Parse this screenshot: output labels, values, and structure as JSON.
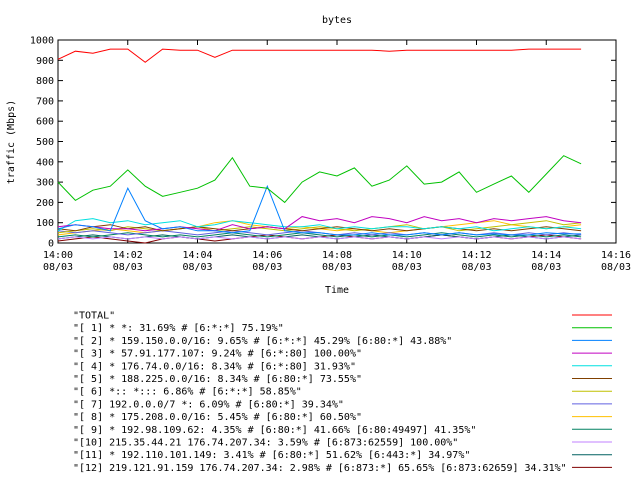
{
  "chart_data": {
    "type": "line",
    "title": "bytes",
    "xlabel": "Time",
    "ylabel": "traffic (Mbps)",
    "xlim": [
      "14:00",
      "14:16"
    ],
    "ylim": [
      0,
      1000
    ],
    "yticks": [
      0,
      100,
      200,
      300,
      400,
      500,
      600,
      700,
      800,
      900,
      1000
    ],
    "xticks": [
      {
        "time": "14:00",
        "date": "08/03"
      },
      {
        "time": "14:02",
        "date": "08/03"
      },
      {
        "time": "14:04",
        "date": "08/03"
      },
      {
        "time": "14:06",
        "date": "08/03"
      },
      {
        "time": "14:08",
        "date": "08/03"
      },
      {
        "time": "14:10",
        "date": "08/03"
      },
      {
        "time": "14:12",
        "date": "08/03"
      },
      {
        "time": "14:14",
        "date": "08/03"
      },
      {
        "time": "14:16",
        "date": "08/03"
      }
    ],
    "grid": false,
    "legend_placement": "bottom",
    "x": [
      "14:00",
      "14:00:30",
      "14:01",
      "14:01:30",
      "14:02",
      "14:02:30",
      "14:03",
      "14:03:30",
      "14:04",
      "14:04:30",
      "14:05",
      "14:05:30",
      "14:06",
      "14:06:30",
      "14:07",
      "14:07:30",
      "14:08",
      "14:08:30",
      "14:09",
      "14:09:30",
      "14:10",
      "14:10:30",
      "14:11",
      "14:11:30",
      "14:12",
      "14:12:30",
      "14:13",
      "14:13:30",
      "14:14",
      "14:14:30",
      "14:15"
    ],
    "series": [
      {
        "name": "\"TOTAL\"",
        "color": "#ff0000",
        "values": [
          905,
          945,
          935,
          955,
          955,
          890,
          955,
          950,
          950,
          915,
          950,
          950,
          950,
          950,
          950,
          950,
          950,
          950,
          950,
          945,
          950,
          950,
          950,
          950,
          950,
          950,
          950,
          955,
          955,
          955,
          955
        ]
      },
      {
        "name": "\"[ 1] * *: 31.69% # [6:*:*] 75.19%\"",
        "color": "#00c000",
        "values": [
          300,
          210,
          260,
          280,
          360,
          280,
          230,
          250,
          270,
          310,
          420,
          280,
          270,
          200,
          300,
          350,
          330,
          370,
          280,
          310,
          380,
          290,
          300,
          350,
          250,
          290,
          330,
          250,
          340,
          430,
          390
        ]
      },
      {
        "name": "\"[ 2] * 159.150.0.0/16: 9.65% # [6:*:*] 45.29% [6:80:*] 43.88%\"",
        "color": "#0080ff",
        "values": [
          70,
          90,
          80,
          60,
          270,
          110,
          70,
          80,
          60,
          60,
          50,
          60,
          280,
          60,
          50,
          50,
          40,
          40,
          50,
          40,
          40,
          50,
          40,
          50,
          40,
          45,
          40,
          40,
          50,
          45,
          45
        ]
      },
      {
        "name": "\"[ 3] * 57.91.177.107: 9.24% # [6:*:80] 100.00%\"",
        "color": "#c000c0",
        "values": [
          80,
          90,
          80,
          70,
          70,
          60,
          70,
          80,
          70,
          60,
          90,
          70,
          80,
          70,
          130,
          110,
          120,
          100,
          130,
          120,
          100,
          130,
          110,
          120,
          100,
          120,
          110,
          120,
          130,
          110,
          100
        ]
      },
      {
        "name": "\"[ 4] * 176.74.0.0/16: 8.34% # [6:*:80] 31.93%\"",
        "color": "#00e0e0",
        "values": [
          60,
          110,
          120,
          100,
          110,
          90,
          100,
          110,
          80,
          90,
          110,
          100,
          90,
          80,
          80,
          90,
          70,
          80,
          70,
          80,
          80,
          70,
          80,
          70,
          80,
          60,
          70,
          80,
          70,
          80,
          70
        ]
      },
      {
        "name": "\"[ 5] * 188.225.0.0/16: 8.34% # [6:80:*] 73.55%\"",
        "color": "#804000",
        "values": [
          70,
          60,
          80,
          90,
          70,
          80,
          60,
          70,
          80,
          70,
          60,
          70,
          80,
          70,
          60,
          70,
          80,
          70,
          60,
          70,
          60,
          70,
          80,
          70,
          60,
          70,
          60,
          70,
          80,
          70,
          60
        ]
      },
      {
        "name": "\"[ 6] *:: *::: 6.86% # [6:*:*] 58.85%\"",
        "color": "#c0c000",
        "values": [
          50,
          60,
          70,
          60,
          80,
          70,
          60,
          70,
          80,
          60,
          70,
          80,
          70,
          60,
          70,
          80,
          70,
          60,
          70,
          80,
          90,
          70,
          80,
          60,
          70,
          80,
          90,
          100,
          110,
          90,
          100
        ]
      },
      {
        "name": "\"[ 7] 192.0.0.0/7 *: 6.09% # [6:80:*] 39.34%\"",
        "color": "#6060e0",
        "values": [
          60,
          50,
          60,
          50,
          40,
          50,
          60,
          50,
          40,
          50,
          60,
          50,
          40,
          50,
          60,
          50,
          40,
          50,
          40,
          50,
          40,
          50,
          40,
          50,
          40,
          50,
          40,
          50,
          40,
          50,
          40
        ]
      },
      {
        "name": "\"[ 8] * 175.208.0.0/16: 5.45% # [6:80:*] 60.50%\"",
        "color": "#ffc000",
        "values": [
          40,
          50,
          60,
          70,
          60,
          50,
          60,
          70,
          80,
          100,
          110,
          90,
          80,
          70,
          80,
          70,
          60,
          70,
          60,
          50,
          60,
          70,
          80,
          90,
          100,
          110,
          90,
          80,
          70,
          80,
          90
        ]
      },
      {
        "name": "\"[ 9] * 192.98.109.62: 4.35% # [6:80:*] 41.66% [6:80:49497] 41.35%\"",
        "color": "#008060",
        "values": [
          30,
          40,
          30,
          40,
          50,
          40,
          30,
          40,
          30,
          40,
          50,
          40,
          30,
          40,
          50,
          40,
          30,
          40,
          30,
          40,
          30,
          40,
          50,
          40,
          30,
          40,
          30,
          40,
          30,
          40,
          30
        ]
      },
      {
        "name": "\"[10] 215.35.44.21 176.74.207.34: 3.59% # [6:873:62559] 100.00%\"",
        "color": "#c080ff",
        "values": [
          20,
          30,
          20,
          30,
          20,
          30,
          20,
          30,
          20,
          30,
          20,
          30,
          20,
          30,
          20,
          30,
          20,
          30,
          20,
          30,
          20,
          30,
          20,
          30,
          20,
          30,
          20,
          30,
          20,
          30,
          20
        ]
      },
      {
        "name": "\"[11] * 192.110.101.149: 3.41% # [6:80:*] 51.62% [6:443:*] 34.97%\"",
        "color": "#006060",
        "values": [
          20,
          30,
          40,
          30,
          20,
          30,
          40,
          30,
          20,
          30,
          40,
          30,
          20,
          30,
          40,
          30,
          20,
          30,
          40,
          30,
          20,
          30,
          40,
          30,
          20,
          30,
          40,
          30,
          20,
          30,
          40
        ]
      },
      {
        "name": "\"[12] 219.121.91.159 176.74.207.34: 2.98% # [6:873:*] 65.65% [6:873:62659] 34.31%\"",
        "color": "#800000",
        "values": [
          10,
          20,
          30,
          20,
          10,
          0,
          20,
          30,
          20,
          10,
          20,
          30,
          40,
          30,
          20,
          30,
          40,
          30,
          20,
          30,
          20,
          30,
          40,
          30,
          20,
          30,
          20,
          30,
          40,
          30,
          20
        ]
      }
    ]
  }
}
